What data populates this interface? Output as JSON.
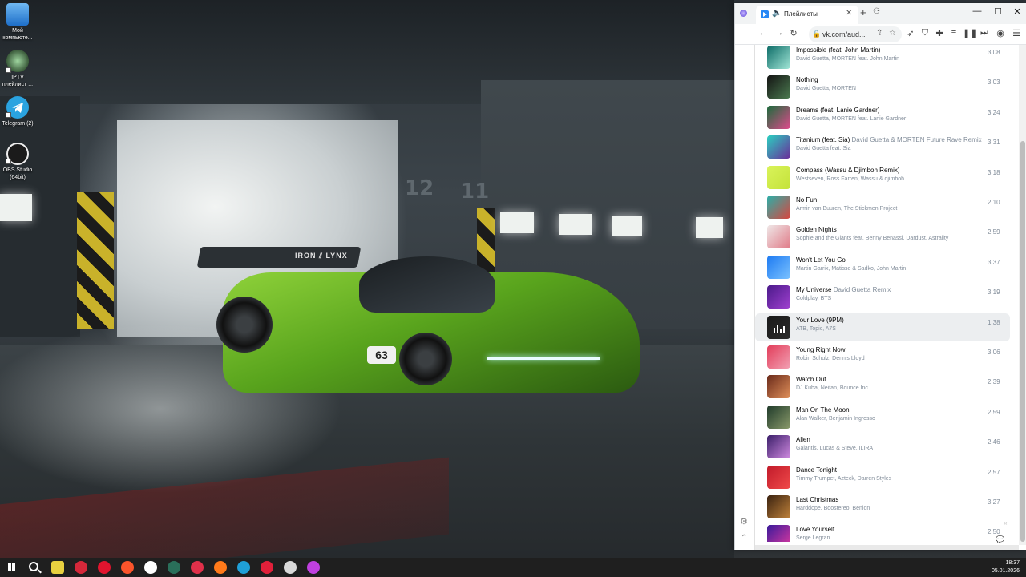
{
  "desktop": {
    "icons": [
      {
        "label": "Мой\nкомпьюте...",
        "icon": "computer-icon"
      },
      {
        "label": "IPTV\nплейлист ...",
        "icon": "iptv-icon"
      },
      {
        "label": "Telegram (2)",
        "icon": "telegram-icon"
      },
      {
        "label": "OBS Studio\n(64bit)",
        "icon": "obs-icon"
      }
    ],
    "door_numbers": [
      "12",
      "11"
    ],
    "car_wing_text": "IRON ⫽ LYNX",
    "car_number": "63"
  },
  "browser": {
    "tab": {
      "title": "Плейлисты",
      "favicon": "vk-audio-icon"
    },
    "address": "vk.com/aud..."
  },
  "tracks": [
    {
      "title": "Impossible (feat. John Martin)",
      "subtitle": "",
      "artist": "David Guetta, MORTEN feat. John Martin",
      "duration": "3:08",
      "cover": [
        "#0c6b66",
        "#a2e7d8"
      ],
      "active": false
    },
    {
      "title": "Nothing",
      "subtitle": "",
      "artist": "David Guetta, MORTEN",
      "duration": "3:03",
      "cover": [
        "#141414",
        "#4b7a4f"
      ],
      "active": false
    },
    {
      "title": "Dreams (feat. Lanie Gardner)",
      "subtitle": "",
      "artist": "David Guetta, MORTEN feat. Lanie Gardner",
      "duration": "3:24",
      "cover": [
        "#1b6b3b",
        "#e04a8d"
      ],
      "active": false
    },
    {
      "title": "Titanium (feat. Sia)",
      "subtitle": "David Guetta & MORTEN Future Rave Remix",
      "artist": "David Guetta feat. Sia",
      "duration": "3:31",
      "cover": [
        "#2ad0c0",
        "#6b2b9a"
      ],
      "active": false
    },
    {
      "title": "Compass (Wassu & Djimboh Remix)",
      "subtitle": "",
      "artist": "Westseven, Ross Farren, Wassu & djimboh",
      "duration": "3:18",
      "cover": [
        "#d9f35a",
        "#c4e23a"
      ],
      "active": false
    },
    {
      "title": "No Fun",
      "subtitle": "",
      "artist": "Armin van Buuren, The Stickmen Project",
      "duration": "2:10",
      "cover": [
        "#2ab0a9",
        "#d9453f"
      ],
      "active": false
    },
    {
      "title": "Golden Nights",
      "subtitle": "",
      "artist": "Sophie and the Giants feat. Benny Benassi, Dardust, Astrality",
      "duration": "2:59",
      "cover": [
        "#efe7e7",
        "#e07a87"
      ],
      "active": false
    },
    {
      "title": "Won't Let You Go",
      "subtitle": "",
      "artist": "Martin Garrix, Matisse & Sadko, John Martin",
      "duration": "3:37",
      "cover": [
        "#1d7af2",
        "#7bc2ff"
      ],
      "active": false
    },
    {
      "title": "My Universe",
      "subtitle": "David Guetta Remix",
      "artist": "Coldplay, BTS",
      "duration": "3:19",
      "cover": [
        "#4b1a8a",
        "#a040d0"
      ],
      "active": false
    },
    {
      "title": "Your Love (9PM)",
      "subtitle": "",
      "artist": "ATB, Topic, A7S",
      "duration": "1:38",
      "cover": [
        "#1a1a1a",
        "#2c2c2c"
      ],
      "active": true
    },
    {
      "title": "Young Right Now",
      "subtitle": "",
      "artist": "Robin Schulz, Dennis Lloyd",
      "duration": "3:06",
      "cover": [
        "#e23d5a",
        "#f2a1b4"
      ],
      "active": false
    },
    {
      "title": "Watch Out",
      "subtitle": "",
      "artist": "DJ Kuba, Neitan, Bounce Inc.",
      "duration": "2:39",
      "cover": [
        "#6a2a1a",
        "#e0905a"
      ],
      "active": false
    },
    {
      "title": "Man On The Moon",
      "subtitle": "",
      "artist": "Alan Walker, Benjamin Ingrosso",
      "duration": "2:59",
      "cover": [
        "#1f3a2a",
        "#8a9a6a"
      ],
      "active": false
    },
    {
      "title": "Alien",
      "subtitle": "",
      "artist": "Galantis, Lucas & Steve, ILIRA",
      "duration": "2:46",
      "cover": [
        "#3b1f6a",
        "#d08ae0"
      ],
      "active": false
    },
    {
      "title": "Dance Tonight",
      "subtitle": "",
      "artist": "Timmy Trumpet, Azteck, Darren Styles",
      "duration": "2:57",
      "cover": [
        "#c11a2a",
        "#f04a4a"
      ],
      "active": false
    },
    {
      "title": "Last Christmas",
      "subtitle": "",
      "artist": "Harddope, Boostereo, Benlon",
      "duration": "3:27",
      "cover": [
        "#3a2210",
        "#c0823a"
      ],
      "active": false
    },
    {
      "title": "Love Yourself",
      "subtitle": "",
      "artist": "Serge Legran",
      "duration": "2:50",
      "cover": [
        "#3a1a9a",
        "#e03aa0"
      ],
      "active": false
    }
  ],
  "taskbar": {
    "apps": [
      {
        "name": "sticky-notes-icon",
        "color": "#e8d040"
      },
      {
        "name": "vivaldi-icon",
        "color": "#d4283a"
      },
      {
        "name": "opera-icon",
        "color": "#e1142e"
      },
      {
        "name": "brave-icon",
        "color": "#fb542b"
      },
      {
        "name": "yandex-browser-icon",
        "color": "#ffffff"
      },
      {
        "name": "chromium-icon",
        "color": "#2a6f5a"
      },
      {
        "name": "app-red-icon",
        "color": "#e0304a"
      },
      {
        "name": "firefox-icon",
        "color": "#ff7a1a"
      },
      {
        "name": "edge-icon",
        "color": "#1fa0d8"
      },
      {
        "name": "opera-gx-icon",
        "color": "#e0203a"
      },
      {
        "name": "chrome-icon",
        "color": "#d9d9d9"
      },
      {
        "name": "gem-icon",
        "color": "#c040e0"
      }
    ],
    "time": "18:37",
    "date": "05.01.2026"
  }
}
